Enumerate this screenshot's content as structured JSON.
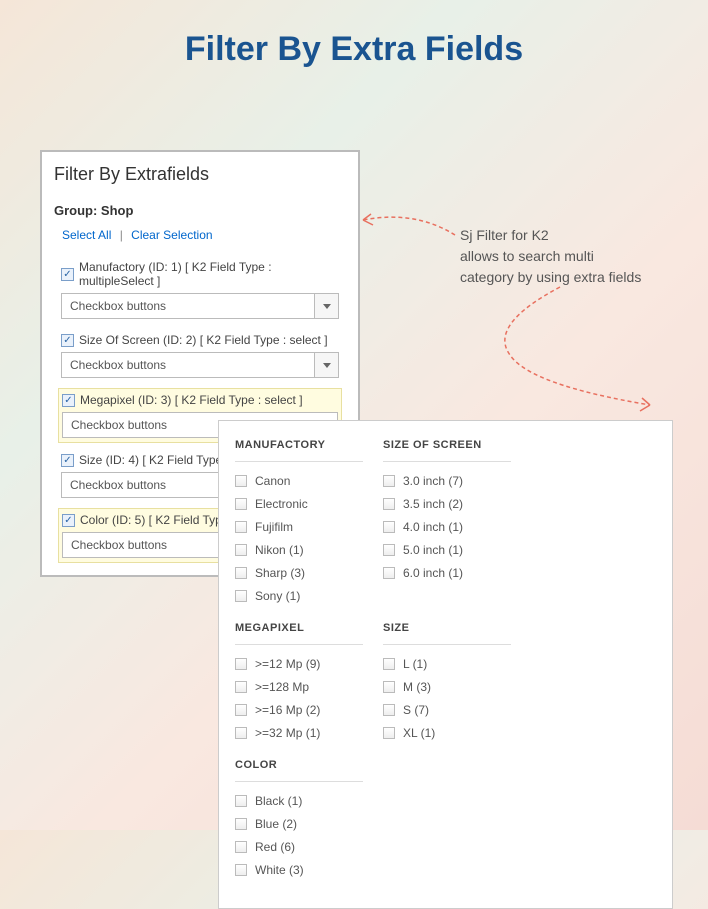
{
  "page_title": "Filter By Extra Fields",
  "annotation_line1": "Sj Filter for K2",
  "annotation_line2": "allows to search multi",
  "annotation_line3": "category by using extra fields",
  "config": {
    "heading": "Filter By Extrafields",
    "group_label": "Group: Shop",
    "select_all": "Select All",
    "clear_selection": "Clear Selection",
    "fields": [
      {
        "label": "Manufactory (ID: 1) [ K2 Field Type : multipleSelect ]",
        "value": "Checkbox buttons",
        "highlighted": false,
        "has_arrow": true
      },
      {
        "label": "Size Of Screen (ID: 2) [ K2 Field Type : select ]",
        "value": "Checkbox buttons",
        "highlighted": false,
        "has_arrow": true
      },
      {
        "label": "Megapixel (ID: 3) [ K2 Field Type : select ]",
        "value": "Checkbox buttons",
        "highlighted": true,
        "has_arrow": false
      },
      {
        "label": "Size (ID: 4) [ K2 Field Type :",
        "value": "Checkbox buttons",
        "highlighted": false,
        "has_arrow": false
      },
      {
        "label": "Color (ID: 5) [ K2 Field Type :",
        "value": "Checkbox buttons",
        "highlighted": true,
        "has_arrow": false
      }
    ]
  },
  "filters": [
    {
      "title": "MANUFACTORY",
      "items": [
        "Canon",
        "Electronic",
        "Fujifilm",
        "Nikon (1)",
        "Sharp (3)",
        "Sony (1)"
      ]
    },
    {
      "title": "SIZE OF SCREEN",
      "items": [
        "3.0 inch (7)",
        "3.5 inch (2)",
        "4.0 inch (1)",
        "5.0 inch (1)",
        "6.0 inch (1)"
      ]
    },
    {
      "title": "MEGAPIXEL",
      "items": [
        ">=12 Mp (9)",
        ">=128 Mp",
        ">=16 Mp (2)",
        ">=32 Mp (1)"
      ]
    },
    {
      "title": "SIZE",
      "items": [
        "L (1)",
        "M (3)",
        "S (7)",
        "XL (1)"
      ]
    },
    {
      "title": "COLOR",
      "items": [
        "Black (1)",
        "Blue (2)",
        "Red (6)",
        "White (3)"
      ]
    }
  ]
}
